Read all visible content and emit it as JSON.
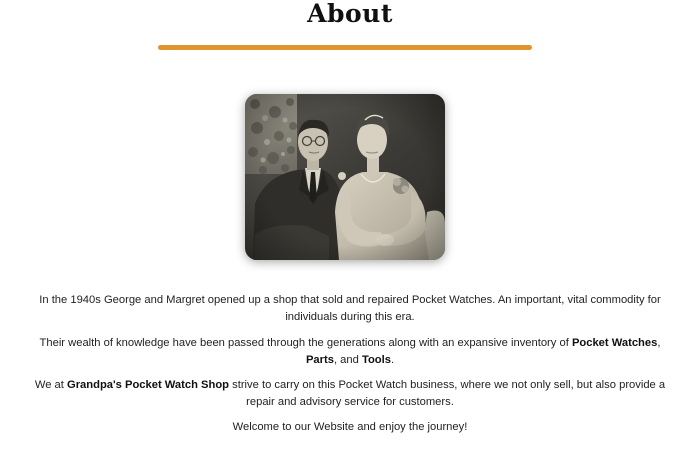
{
  "heading": "About",
  "accent_color": "#e0952c",
  "photo_icon": "vintage-couple-photo",
  "paragraphs": {
    "p1": "In the 1940s George and Margret opened up a shop that sold and repaired Pocket Watches. An important, vital commodity for individuals during this era.",
    "p2": {
      "before": "Their wealth of knowledge have been passed through the generations along with an expansive inventory of ",
      "bold1": "Pocket Watches",
      "sep1": ", ",
      "bold2": "Parts",
      "sep2": ", and ",
      "bold3": "Tools",
      "after": "."
    },
    "p3": {
      "before": "We at ",
      "bold": "Grandpa's Pocket Watch Shop",
      "after": " strive to carry on this Pocket Watch business, where we not only sell, but also provide a repair and advisory service for customers."
    },
    "p4": "Welcome to our Website and enjoy the journey!"
  }
}
